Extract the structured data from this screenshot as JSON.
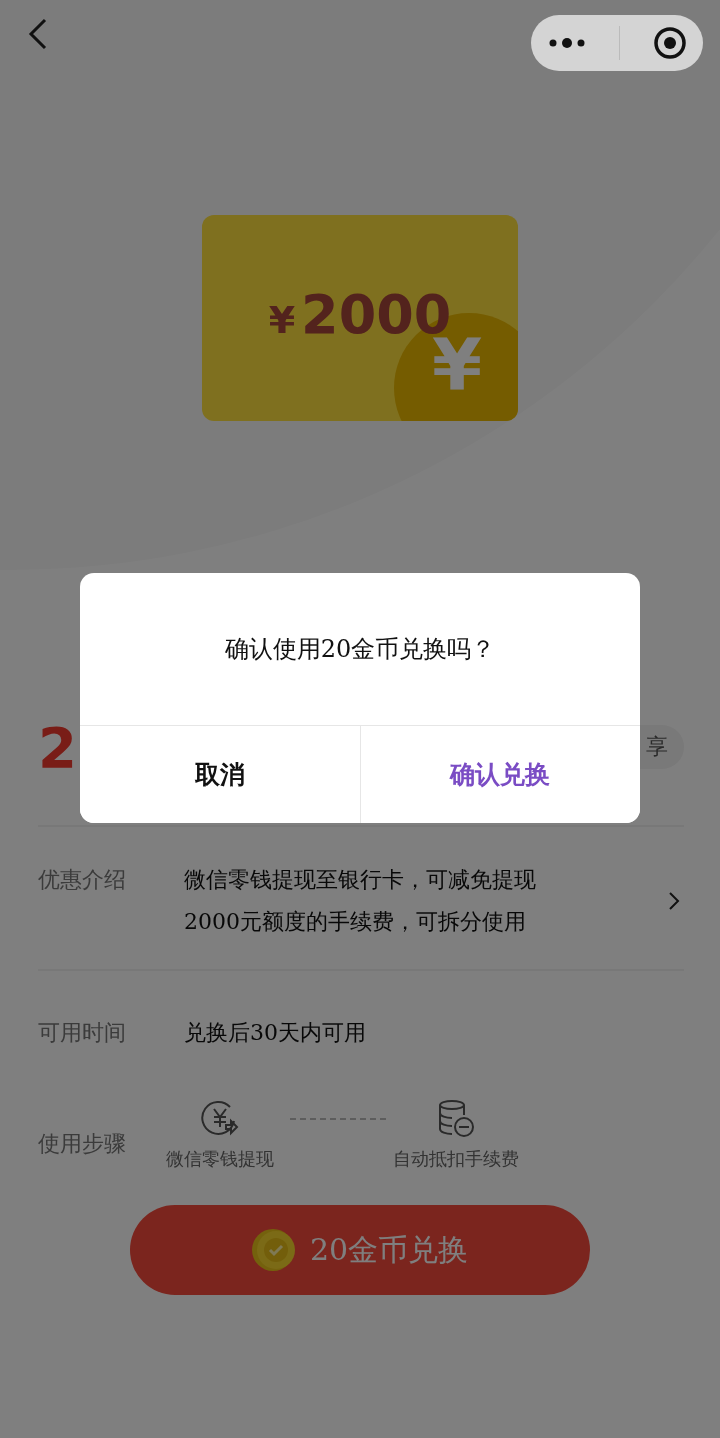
{
  "card": {
    "currency": "¥",
    "amount": "2000",
    "coin_symbol": "¥"
  },
  "price": {
    "value": "2"
  },
  "share_button": {
    "label": "享"
  },
  "details": [
    {
      "kind": "link",
      "label": "优惠介绍",
      "lines": [
        "微信零钱提现至银行卡，可减免提现",
        "2000元额度的手续费，可拆分使用"
      ]
    },
    {
      "kind": "text",
      "label": "可用时间",
      "lines": [
        "兑换后30天内可用"
      ]
    },
    {
      "kind": "steps",
      "label": "使用步骤",
      "steps": [
        {
          "kind": "withdraw",
          "label": "微信零钱提现"
        },
        {
          "kind": "deduct",
          "label": "自动抵扣手续费"
        }
      ]
    }
  ],
  "exchange_button": {
    "label": "20金币兑换"
  },
  "dialog": {
    "message": "确认使用20金币兑换吗？",
    "buttons": [
      {
        "kind": "cancel",
        "label": "取消"
      },
      {
        "kind": "confirm",
        "label": "确认兑换"
      }
    ]
  }
}
